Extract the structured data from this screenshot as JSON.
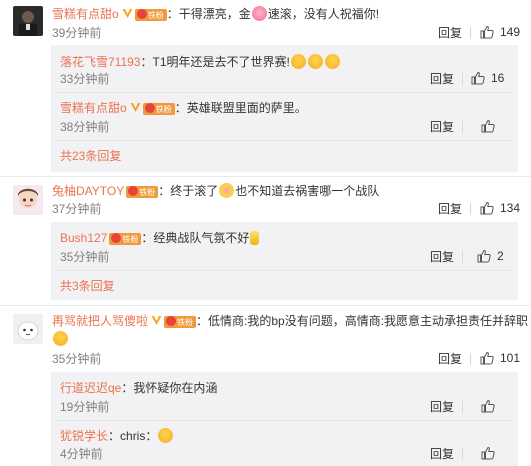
{
  "comments": [
    {
      "user": "雪糕有点甜o",
      "text": "：干得漂亮，金",
      "text2": "速滚，没有人祝福你!",
      "time": "39分钟前",
      "reply": "回复",
      "likes": "149",
      "replies": [
        {
          "user": "落花飞雪71193",
          "text": "：T1明年还是去不了世界赛!",
          "time": "33分钟前",
          "reply": "回复",
          "likes": "16"
        },
        {
          "user": "雪糕有点甜o",
          "text": "：英雄联盟里面的萨里。",
          "time": "38分钟前",
          "reply": "回复",
          "likes": ""
        }
      ],
      "more": "共23条回复"
    },
    {
      "user": "兔柚DAYTOY",
      "text": "：终于滚了",
      "text2": "也不知道去祸害哪一个战队",
      "time": "37分钟前",
      "reply": "回复",
      "likes": "134",
      "replies": [
        {
          "user": "Bush127",
          "text": "：经典战队气氛不好",
          "time": "35分钟前",
          "reply": "回复",
          "likes": "2"
        }
      ],
      "more": "共3条回复"
    },
    {
      "user": "再骂就把人骂傻啦",
      "text": "：低情商:我的bp没有问题，高情商:我愿意主动承担责任并辞职",
      "time": "35分钟前",
      "reply": "回复",
      "likes": "101",
      "replies": [
        {
          "user": "行道迟迟qe",
          "text": "：我怀疑你在内涵",
          "time": "19分钟前",
          "reply": "回复",
          "likes": ""
        },
        {
          "user": "犹锐学长",
          "text": "：chris：",
          "time": "4分钟前",
          "reply": "回复",
          "likes": ""
        }
      ]
    }
  ],
  "fan_badge": "铁粉",
  "colors": {
    "username": "#eb7350",
    "reply_bg": "#f2f2f5",
    "time": "#808080"
  },
  "icons": {
    "like": "thumbs-up-icon",
    "verified": "verified-v-icon",
    "fan": "fan-badge-icon"
  }
}
